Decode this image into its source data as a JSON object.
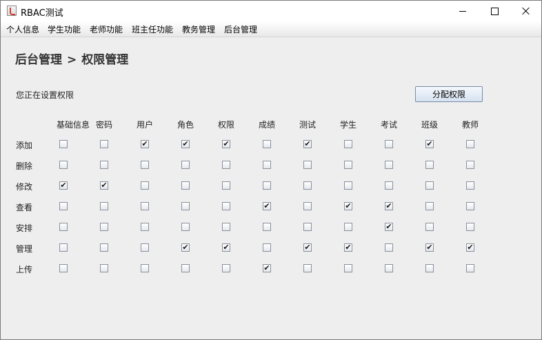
{
  "window": {
    "title": "RBAC测试"
  },
  "menubar": {
    "items": [
      "个人信息",
      "学生功能",
      "老师功能",
      "班主任功能",
      "教务管理",
      "后台管理"
    ]
  },
  "breadcrumb": {
    "parent": "后台管理",
    "separator": ">",
    "current": "权限管理"
  },
  "status_text": "您正在设置权限",
  "assign_button_label": "分配权限",
  "permissions": {
    "columns": [
      "基础信息",
      "密码",
      "用户",
      "角色",
      "权限",
      "成绩",
      "测试",
      "学生",
      "考试",
      "班级",
      "教师"
    ],
    "rows": [
      {
        "label": "添加",
        "checked": [
          false,
          false,
          true,
          true,
          true,
          false,
          true,
          false,
          false,
          true,
          false
        ]
      },
      {
        "label": "删除",
        "checked": [
          false,
          false,
          false,
          false,
          false,
          false,
          false,
          false,
          false,
          false,
          false
        ]
      },
      {
        "label": "修改",
        "checked": [
          true,
          true,
          false,
          false,
          false,
          false,
          false,
          false,
          false,
          false,
          false
        ]
      },
      {
        "label": "查看",
        "checked": [
          false,
          false,
          false,
          false,
          false,
          true,
          false,
          true,
          true,
          false,
          false
        ]
      },
      {
        "label": "安排",
        "checked": [
          false,
          false,
          false,
          false,
          false,
          false,
          false,
          false,
          true,
          false,
          false
        ]
      },
      {
        "label": "管理",
        "checked": [
          false,
          false,
          false,
          true,
          true,
          false,
          true,
          true,
          false,
          true,
          true
        ]
      },
      {
        "label": "上传",
        "checked": [
          false,
          false,
          false,
          false,
          false,
          true,
          false,
          false,
          false,
          false,
          false
        ]
      }
    ]
  },
  "icons": {
    "app": "java-coffee-icon",
    "minimize": "minimize-icon",
    "maximize": "maximize-icon",
    "close": "close-icon",
    "check": "checkmark-icon"
  }
}
